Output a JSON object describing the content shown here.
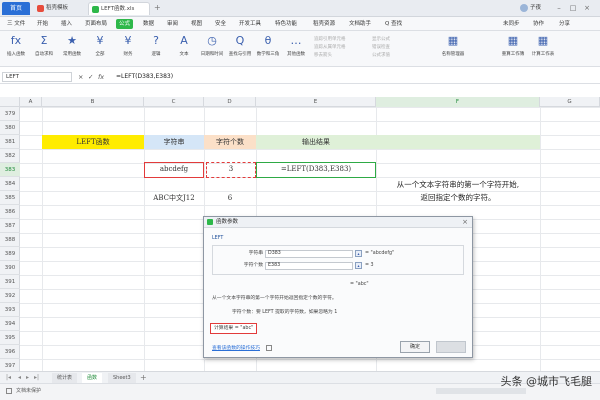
{
  "titlebar": {
    "home_tab": "首页",
    "tabs": [
      "稻壳模板",
      "LEFT函数.xls"
    ],
    "user": "子夜"
  },
  "menu": {
    "items": [
      "三 文件",
      "开始",
      "插入",
      "页面布局",
      "公式",
      "数据",
      "审阅",
      "视图",
      "安全",
      "开发工具",
      "特色功能",
      "稻壳资源",
      "文档助手",
      "Q 查找"
    ],
    "active_index": 4,
    "right": [
      "未同步",
      "协作",
      "分享"
    ]
  },
  "ribbon": {
    "buttons": [
      {
        "icon": "fx",
        "label": "插入函数"
      },
      {
        "icon": "Σ",
        "label": "自动求和"
      },
      {
        "icon": "★",
        "label": "常用函数"
      },
      {
        "icon": "¥",
        "label": "全部"
      },
      {
        "icon": "¥",
        "label": "财务"
      },
      {
        "icon": "?",
        "label": "逻辑"
      },
      {
        "icon": "A",
        "label": "文本"
      },
      {
        "icon": "◷",
        "label": "日期和时间"
      },
      {
        "icon": "Q",
        "label": "查找与引用"
      },
      {
        "icon": "θ",
        "label": "数学和三角"
      },
      {
        "icon": "…",
        "label": "其他函数"
      },
      {
        "icon": "▦",
        "label": "名称管理器"
      },
      {
        "icon": "▦",
        "label": "重算工作簿"
      },
      {
        "icon": "▦",
        "label": "计算工作表"
      }
    ],
    "small_items": [
      "追踪引用单元格",
      "追踪从属单元格",
      "移去箭头",
      "显示公式",
      "错误检查",
      "公式求值"
    ]
  },
  "formula_bar": {
    "name_box": "LEFT",
    "formula": "=LEFT(D383,E383)"
  },
  "grid": {
    "columns": [
      "A",
      "B",
      "C",
      "D",
      "E",
      "F",
      "G"
    ],
    "selected_column": "F",
    "rows": [
      "379",
      "380",
      "381",
      "382",
      "383",
      "384",
      "385",
      "386",
      "387",
      "388",
      "389",
      "390",
      "391",
      "392",
      "393",
      "394",
      "395",
      "396",
      "397",
      "398"
    ],
    "selected_row": "383",
    "cells": {
      "left_function": "LEFT函数",
      "header_string": "字符串",
      "header_count": "字符个数",
      "header_output": "输出结果",
      "d383": "abcdefg",
      "e383": "3",
      "f383": "=LEFT(D383,E383)",
      "d385": "ABC中文J12",
      "e385": "6",
      "desc_line1": "从一个文本字符串的第一个字符开始,",
      "desc_line2": "返回指定个数的字符。"
    }
  },
  "dialog": {
    "title": "函数参数",
    "function_name": "LEFT",
    "param1_label": "字符串",
    "param1_value": "D383",
    "param1_result": "= \"abcdefg\"",
    "param2_label": "字符个数",
    "param2_value": "E383",
    "param2_result": "= 3",
    "total_result": "= \"abc\"",
    "description": "从一个文本字符串的第一个字符开始返回指定个数的字符。",
    "param_help": "字符个数：要 LEFT 提取的字符数，如果忽略为 1",
    "calc_result": "计算结果 = \"abc\"",
    "help_link": "查看该函数的操作技巧",
    "ok_label": "确定"
  },
  "sheets": {
    "tabs": [
      "统计表",
      "函数",
      "Sheet3"
    ],
    "active_index": 1,
    "add": "+"
  },
  "status": {
    "left": "文档未保护"
  },
  "watermark": "头条 @城市飞毛腿",
  "colors": {
    "accent_green": "#2eb84a",
    "highlight_red": "#e23b3b",
    "yellow": "#ffec00"
  }
}
